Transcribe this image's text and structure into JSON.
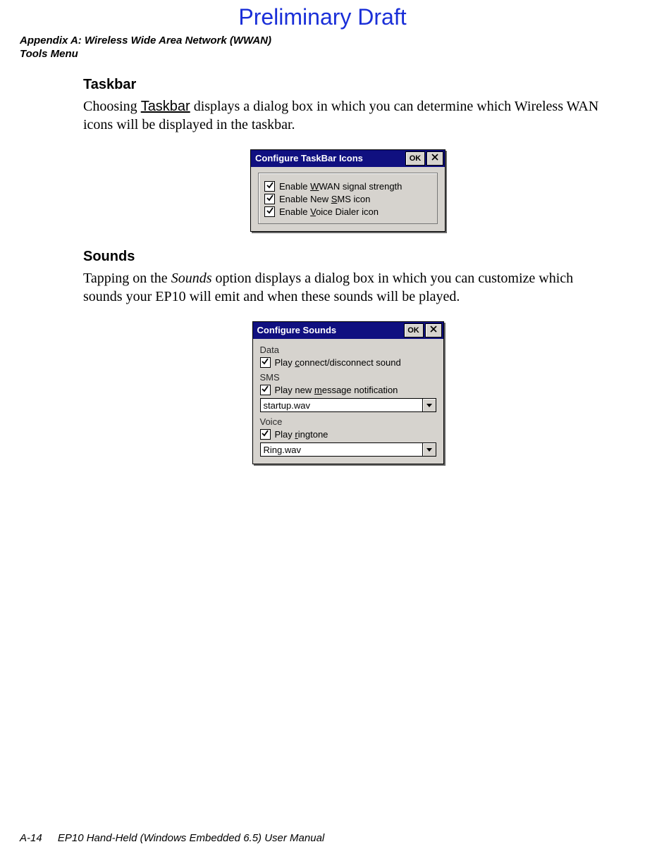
{
  "draft_text": "Preliminary Draft",
  "header": {
    "line1": "Appendix A: Wireless Wide Area Network (WWAN)",
    "line2": "Tools Menu"
  },
  "section1": {
    "heading": "Taskbar",
    "para_pre": "Choosing ",
    "para_link": "Taskbar",
    "para_post": " displays a dialog box in which you can determine which Wireless WAN icons will be displayed in the taskbar."
  },
  "dialog1": {
    "title": "Configure TaskBar Icons",
    "ok": "OK",
    "items": [
      {
        "prefix": "Enable ",
        "ul": "W",
        "suffix": "WAN signal strength"
      },
      {
        "prefix": "Enable New ",
        "ul": "S",
        "suffix": "MS icon"
      },
      {
        "prefix": "Enable ",
        "ul": "V",
        "suffix": "oice Dialer icon"
      }
    ]
  },
  "section2": {
    "heading": "Sounds",
    "para_pre": "Tapping on the ",
    "para_em": "Sounds",
    "para_post": " option displays a dialog box in which you can customize which sounds your EP10 will emit and when these sounds will be played."
  },
  "dialog2": {
    "title": "Configure Sounds",
    "ok": "OK",
    "group_data": "Data",
    "cb_data": {
      "prefix": "Play ",
      "ul": "c",
      "suffix": "onnect/disconnect sound"
    },
    "group_sms": "SMS",
    "cb_sms": {
      "prefix": "Play new ",
      "ul": "m",
      "suffix": "essage notification"
    },
    "sel_sms": "startup.wav",
    "group_voice": "Voice",
    "cb_voice": {
      "prefix": "Play ",
      "ul": "r",
      "suffix": "ingtone"
    },
    "sel_voice": "Ring.wav"
  },
  "footer": {
    "page": "A-14",
    "title": "EP10 Hand-Held (Windows Embedded 6.5) User Manual"
  }
}
